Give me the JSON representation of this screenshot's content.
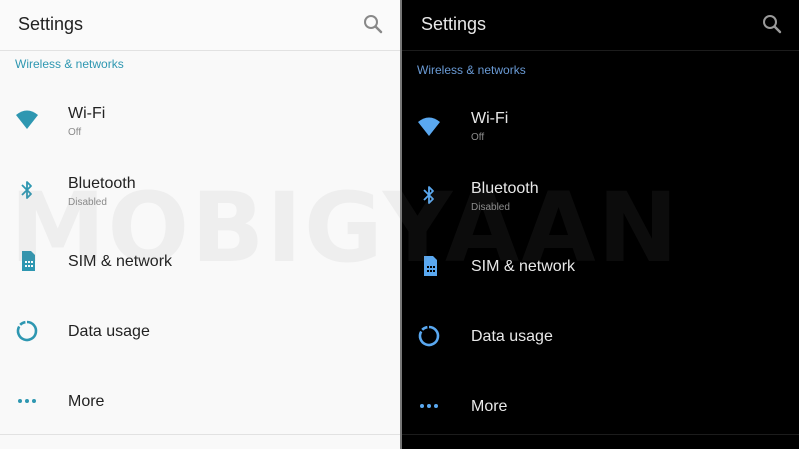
{
  "colors": {
    "light_accent": "#2e97b1",
    "dark_accent": "#6a9bd6",
    "light_bg": "#f9f9f9",
    "dark_bg": "#000000"
  },
  "light": {
    "title": "Settings",
    "section": "Wireless & networks",
    "items": [
      {
        "icon": "wifi-icon",
        "label": "Wi-Fi",
        "sub": "Off"
      },
      {
        "icon": "bluetooth-icon",
        "label": "Bluetooth",
        "sub": "Disabled"
      },
      {
        "icon": "sim-card-icon",
        "label": "SIM & network"
      },
      {
        "icon": "data-usage-icon",
        "label": "Data usage"
      },
      {
        "icon": "more-icon",
        "label": "More"
      }
    ]
  },
  "dark": {
    "title": "Settings",
    "section": "Wireless & networks",
    "items": [
      {
        "icon": "wifi-icon",
        "label": "Wi-Fi",
        "sub": "Off"
      },
      {
        "icon": "bluetooth-icon",
        "label": "Bluetooth",
        "sub": "Disabled"
      },
      {
        "icon": "sim-card-icon",
        "label": "SIM & network"
      },
      {
        "icon": "data-usage-icon",
        "label": "Data usage"
      },
      {
        "icon": "more-icon",
        "label": "More"
      }
    ]
  },
  "watermark": "MOBIGYAAN"
}
